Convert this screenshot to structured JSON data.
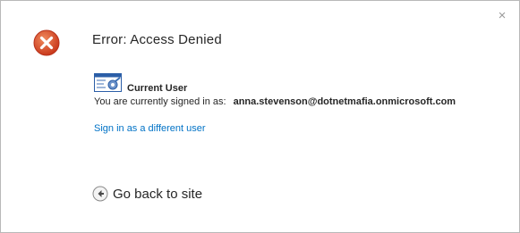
{
  "dialog": {
    "close_glyph": "×",
    "title": "Error: Access Denied",
    "icons": {
      "error": "error-x-icon",
      "user": "user-settings-icon",
      "back": "back-arrow-icon",
      "close": "close-icon"
    }
  },
  "current_user": {
    "heading": "Current User",
    "signed_in_prefix": "You are currently signed in as:",
    "email": "anna.stevenson@dotnetmafia.onmicrosoft.com"
  },
  "links": {
    "sign_in_different": "Sign in as a different user",
    "go_back": "Go back to site"
  },
  "colors": {
    "error_red": "#d9482b",
    "link_blue": "#0072c6",
    "text": "#262626",
    "border": "#b9b9b9"
  }
}
